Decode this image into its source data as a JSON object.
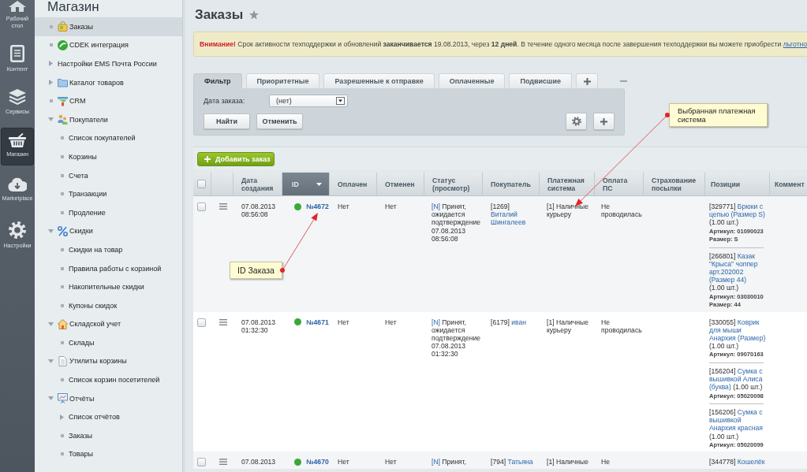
{
  "nav": {
    "items": [
      {
        "label": "Рабочий стол",
        "kind": "home",
        "selected": false
      },
      {
        "label": "Контент",
        "kind": "document",
        "selected": false
      },
      {
        "label": "Сервисы",
        "kind": "layers",
        "selected": false
      },
      {
        "label": "Магазин",
        "kind": "basket",
        "selected": true
      },
      {
        "label": "Marketplace",
        "kind": "cloud",
        "selected": false
      },
      {
        "label": "Настройки",
        "kind": "gear",
        "selected": false
      }
    ]
  },
  "sidebar": {
    "title": "Магазин",
    "items": [
      {
        "label": "Заказы",
        "kind": "bag",
        "selected": true
      },
      {
        "label": "CDEK интеграция",
        "kind": "disc",
        "selected": false
      },
      {
        "label": "Настройки EMS Почта России",
        "kind": "plain",
        "selected": false,
        "expanded": false
      },
      {
        "label": "Каталог товаров",
        "kind": "folder",
        "selected": false,
        "expanded": false
      },
      {
        "label": "CRM",
        "kind": "funnel",
        "selected": false
      },
      {
        "label": "Покупатели",
        "kind": "people",
        "selected": false,
        "expanded": true,
        "children": [
          {
            "label": "Список покупателей",
            "selected": false
          },
          {
            "label": "Корзины",
            "selected": false
          },
          {
            "label": "Счета",
            "selected": false
          },
          {
            "label": "Транзакции",
            "selected": false
          },
          {
            "label": "Продление",
            "selected": false
          }
        ]
      },
      {
        "label": "Скидки",
        "kind": "percent",
        "selected": false,
        "expanded": true,
        "children": [
          {
            "label": "Скидки на товар",
            "selected": false
          },
          {
            "label": "Правила работы с корзиной",
            "selected": false
          },
          {
            "label": "Накопительные скидки",
            "selected": false
          },
          {
            "label": "Купоны скидок",
            "selected": false
          }
        ]
      },
      {
        "label": "Складской учет",
        "kind": "house",
        "selected": false,
        "expanded": true,
        "children": [
          {
            "label": "Склады",
            "selected": false
          }
        ]
      },
      {
        "label": "Утилиты корзины",
        "kind": "page",
        "selected": false,
        "expanded": true,
        "children": [
          {
            "label": "Список корзин посетителей",
            "selected": false
          }
        ]
      },
      {
        "label": "Отчёты",
        "kind": "board",
        "selected": false,
        "expanded": true,
        "children": [
          {
            "label": "Список отчётов",
            "selected": false,
            "expanded": false
          },
          {
            "label": "Заказы",
            "selected": false
          },
          {
            "label": "Товары",
            "selected": false
          }
        ]
      }
    ]
  },
  "page": {
    "title": "Заказы"
  },
  "notice": {
    "warning": "Внимание!",
    "text": "Срок активности техподдержки и обновлений **заканчивается** 19.08.2013, через **12 дней**. В течение одного месяца после завершения техподдержки вы можете приобрести",
    "link": "льготно"
  },
  "filter": {
    "tabs": [
      {
        "label": "Фильтр",
        "selected": true
      },
      {
        "label": "Приоритетные",
        "selected": false
      },
      {
        "label": "Разрешенные к отправке",
        "selected": false
      },
      {
        "label": "Оплаченные",
        "selected": false
      },
      {
        "label": "Подвисшие",
        "selected": false
      }
    ],
    "field": {
      "label": "Дата заказа:",
      "value": "(нет)"
    },
    "buttons": [
      "Найти",
      "Отменить"
    ]
  },
  "toolbar": {
    "add_button": "Добавить заказ"
  },
  "table": {
    "select_all": {
      "checked": false
    },
    "columns": [
      {
        "label": "Дата создания",
        "sorted": false
      },
      {
        "label": "ID",
        "sorted": true
      },
      {
        "label": "Оплачен",
        "sorted": false
      },
      {
        "label": "Отменен",
        "sorted": false
      },
      {
        "label": "Статус (просмотр)",
        "sorted": false
      },
      {
        "label": "Покупатель",
        "sorted": false
      },
      {
        "label": "Платежная система",
        "sorted": false
      },
      {
        "label": "Оплата ПС",
        "sorted": false
      },
      {
        "label": "Страхование посылки",
        "sorted": false
      },
      {
        "label": "Позиции",
        "sorted": false
      },
      {
        "label": "Коммент",
        "sorted": false
      }
    ],
    "rows": [
      {
        "checked": false,
        "date": "07.08.2013 08:56:08",
        "color": "#3aa935",
        "id": "№4672",
        "paid": "Нет",
        "canceled": "Нет",
        "status_link": "[N]",
        "status": "Принят, ожидается подтверждение 07.08.2013 08:56:08",
        "buyer_id": "[1269]",
        "buyer": "Виталий Шингалеев",
        "payment": "[1] Наличные курьеру",
        "payment_status": "Не проводилась",
        "positions": [
          {
            "id": "[329771]",
            "name": "Брюки с цепью (Размер S)",
            "qty": "(1.00 шт.)",
            "props": [
              "Артикул: 01090023",
              "Размер: S"
            ]
          },
          {
            "id": "[266801]",
            "name": "Казак \"Крыса\" чоппер арт.202002 (Размер 44)",
            "qty": "(1.00 шт.)",
            "props": [
              "Артикул: 03030010",
              "Размер: 44"
            ]
          }
        ]
      },
      {
        "checked": false,
        "date": "07.08.2013 01:32:30",
        "color": "#3aa935",
        "id": "№4671",
        "paid": "Нет",
        "canceled": "Нет",
        "status_link": "[N]",
        "status": "Принят, ожидается подтверждение 07.08.2013 01:32:30",
        "buyer_id": "[6179]",
        "buyer": "иван",
        "payment": "[1] Наличные курьеру",
        "payment_status": "Не проводилась",
        "positions": [
          {
            "id": "[330055]",
            "name": "Коврик для мыши Анархия (Размер)",
            "qty": "(1.00 шт.)",
            "props": [
              "Артикул: 09070163"
            ]
          },
          {
            "id": "[156204]",
            "name": "Сумка с вышивкой Алиса (буква)",
            "qty": "(1.00 шт.)",
            "props": [
              "Артикул: 05020098"
            ]
          },
          {
            "id": "[156206]",
            "name": "Сумка с вышивкой Анархия красная",
            "qty": "(1.00 шт.)",
            "props": [
              "Артикул: 05020099"
            ]
          }
        ]
      },
      {
        "checked": false,
        "date": "07.08.2013",
        "color": "#3aa935",
        "id": "№4670",
        "paid": "Нет",
        "canceled": "Нет",
        "status_link": "[N]",
        "status": "Принят,",
        "buyer_id": "[794]",
        "buyer": "Татьяна",
        "payment": "[1] Наличные",
        "payment_status": "Не",
        "positions": [
          {
            "id": "[344778]",
            "name": "Кошелёк"
          }
        ]
      }
    ]
  },
  "annotations": [
    {
      "text": "ID Заказа"
    },
    {
      "text": "Выбранная платежная система"
    }
  ]
}
